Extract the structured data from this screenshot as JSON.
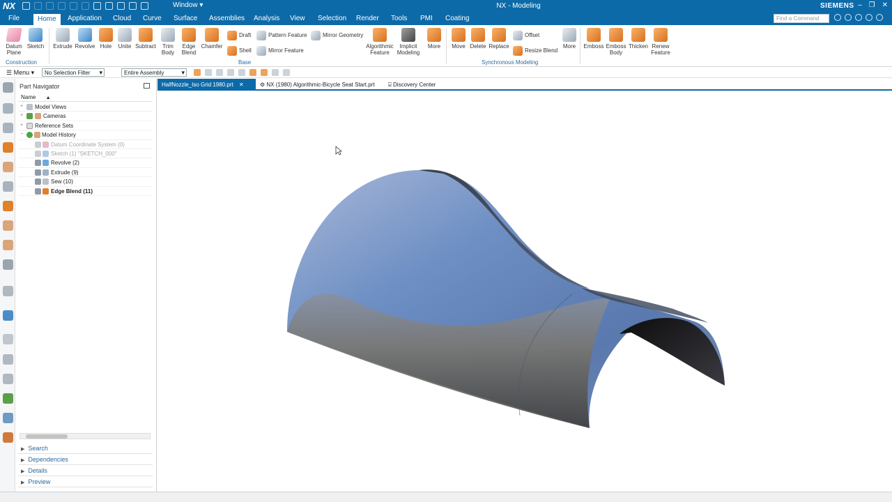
{
  "titlebar": {
    "logo": "NX",
    "window_menu": "Window ▾",
    "title": "NX - Modeling",
    "brand": "SIEMENS",
    "window_controls": [
      "–",
      "❐",
      "✕"
    ]
  },
  "menubar": {
    "tabs": [
      "File",
      "Home",
      "Application",
      "Cloud",
      "Curve",
      "Surface",
      "Assemblies",
      "Analysis",
      "View",
      "Selection",
      "Render",
      "Tools",
      "PMI",
      "Coating"
    ],
    "active_tab": "Home",
    "command_search_placeholder": "Find a Command"
  },
  "ribbon": {
    "construction": {
      "buttons": [
        {
          "label": "Datum Plane",
          "icon": "datum-plane-icon"
        },
        {
          "label": "Sketch",
          "icon": "sketch-icon"
        }
      ],
      "group_label": "Construction"
    },
    "base": {
      "buttons": [
        {
          "label": "Extrude",
          "icon": "extrude-icon"
        },
        {
          "label": "Revolve",
          "icon": "revolve-icon"
        },
        {
          "label": "Hole",
          "icon": "hole-icon"
        },
        {
          "label": "Unite",
          "icon": "unite-icon"
        },
        {
          "label": "Subtract",
          "icon": "subtract-icon"
        },
        {
          "label": "Trim Body",
          "icon": "trim-body-icon"
        },
        {
          "label": "Edge Blend",
          "icon": "edge-blend-icon"
        },
        {
          "label": "Chamfer",
          "icon": "chamfer-icon"
        }
      ],
      "small_buttons": [
        "Draft",
        "Shell",
        "Pattern Feature",
        "Mirror Feature",
        "Mirror Geometry"
      ],
      "large_buttons": [
        "Algorithmic Feature",
        "Implicit Modeling",
        "More"
      ],
      "group_label": "Base"
    },
    "synchronous": {
      "buttons": [
        "Move",
        "Delete",
        "Replace"
      ],
      "small_buttons": [
        "Offset",
        "Resize Blend"
      ],
      "more": "More",
      "group_label": "Synchronous Modeling"
    },
    "emboss": {
      "buttons": [
        "Emboss",
        "Emboss Body",
        "Thicken",
        "Renew Feature"
      ]
    }
  },
  "toolbar2": {
    "menu_label": "Menu",
    "selection_filter": "No Selection Filter",
    "scope": "Entire Assembly"
  },
  "navigator": {
    "title": "Part Navigator",
    "column_header": "Name",
    "nodes": [
      {
        "label": "Model Views",
        "level": 0,
        "expander": "+",
        "state": "normal"
      },
      {
        "label": "Cameras",
        "level": 0,
        "expander": "+",
        "state": "normal"
      },
      {
        "label": "Reference Sets",
        "level": 0,
        "expander": "+",
        "state": "normal"
      },
      {
        "label": "Model History",
        "level": 0,
        "expander": "−",
        "state": "normal"
      },
      {
        "label": "Datum Coordinate System (0)",
        "level": 1,
        "expander": "",
        "state": "dim"
      },
      {
        "label": "Sketch (1) \"SKETCH_000\"",
        "level": 1,
        "expander": "",
        "state": "dim"
      },
      {
        "label": "Revolve (2)",
        "level": 1,
        "expander": "",
        "state": "normal"
      },
      {
        "label": "Extrude (9)",
        "level": 1,
        "expander": "",
        "state": "normal"
      },
      {
        "label": "Sew (10)",
        "level": 1,
        "expander": "",
        "state": "normal"
      },
      {
        "label": "Edge Blend (11)",
        "level": 1,
        "expander": "",
        "state": "bold"
      }
    ],
    "accordion": [
      "Search",
      "Dependencies",
      "Details",
      "Preview"
    ]
  },
  "doc_tabs": [
    {
      "label": "HalfNozzle_Iso Grid 1980.prt",
      "active": true
    },
    {
      "label": "NX (1980) Algorithmic-Bicycle Seat Start.prt",
      "active": false
    },
    {
      "label": "Discovery Center",
      "active": false
    }
  ],
  "colors": {
    "brand_blue": "#0d6aa8",
    "accent_orange": "#e0802a",
    "surface_blue": "#6d8fc4"
  }
}
